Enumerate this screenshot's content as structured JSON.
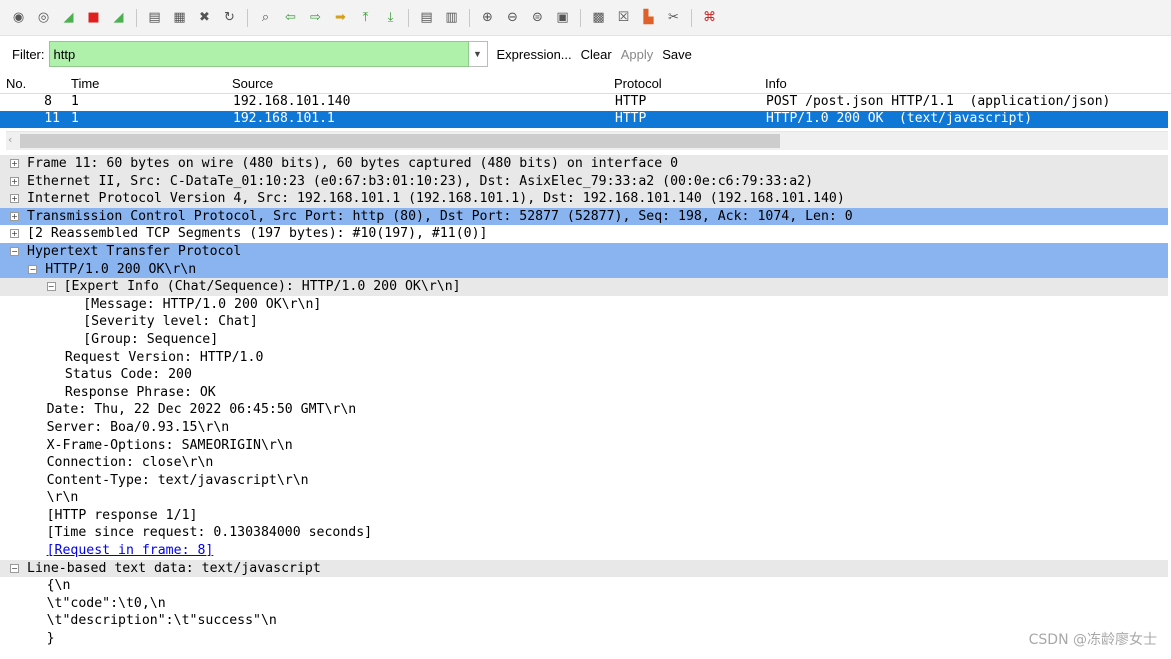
{
  "toolbar": {
    "icons": [
      "start-capture-icon",
      "capture-options-icon",
      "shark-fin-icon",
      "stop-capture-icon",
      "restart-capture-icon",
      "open-file-icon",
      "save-file-icon",
      "close-file-icon",
      "reload-icon",
      "find-packet-icon",
      "go-back-icon",
      "go-forward-icon",
      "go-to-packet-icon",
      "go-first-icon",
      "go-last-icon",
      "colorize-icon",
      "auto-scroll-icon",
      "zoom-in-icon",
      "zoom-out-icon",
      "normal-size-icon",
      "resize-columns-icon",
      "capture-filters-icon",
      "display-filters-icon",
      "coloring-rules-icon",
      "preferences-icon",
      "help-icon"
    ]
  },
  "filter": {
    "label": "Filter:",
    "value": "http",
    "expression": "Expression...",
    "clear": "Clear",
    "apply": "Apply",
    "save": "Save"
  },
  "packet_list": {
    "columns": {
      "no": "No.",
      "time": "Time",
      "source": "Source",
      "protocol": "Protocol",
      "info": "Info"
    },
    "rows": [
      {
        "no": "8",
        "time": "1",
        "source": "192.168.101.140",
        "protocol": "HTTP",
        "info": "POST /post.json HTTP/1.1  (application/json)",
        "selected": false
      },
      {
        "no": "11",
        "time": "1",
        "source": "192.168.101.1",
        "protocol": "HTTP",
        "info": "HTTP/1.0 200 OK  (text/javascript)",
        "selected": true
      }
    ]
  },
  "details": [
    {
      "indent": 0,
      "exp": "+",
      "bg": "gray",
      "text": "Frame 11: 60 bytes on wire (480 bits), 60 bytes captured (480 bits) on interface 0"
    },
    {
      "indent": 0,
      "exp": "+",
      "bg": "gray",
      "text": "Ethernet II, Src: C-DataTe_01:10:23 (e0:67:b3:01:10:23), Dst: AsixElec_79:33:a2 (00:0e:c6:79:33:a2)"
    },
    {
      "indent": 0,
      "exp": "+",
      "bg": "gray",
      "text": "Internet Protocol Version 4, Src: 192.168.101.1 (192.168.101.1), Dst: 192.168.101.140 (192.168.101.140)"
    },
    {
      "indent": 0,
      "exp": "+",
      "bg": "blue",
      "text": "Transmission Control Protocol, Src Port: http (80), Dst Port: 52877 (52877), Seq: 198, Ack: 1074, Len: 0"
    },
    {
      "indent": 0,
      "exp": "+",
      "bg": "none",
      "text": "[2 Reassembled TCP Segments (197 bytes): #10(197), #11(0)]"
    },
    {
      "indent": 0,
      "exp": "-",
      "bg": "blue",
      "text": "Hypertext Transfer Protocol"
    },
    {
      "indent": 1,
      "exp": "-",
      "bg": "blue",
      "text": "HTTP/1.0 200 OK\\r\\n"
    },
    {
      "indent": 2,
      "exp": "-",
      "bg": "gray",
      "text": "[Expert Info (Chat/Sequence): HTTP/1.0 200 OK\\r\\n]"
    },
    {
      "indent": 4,
      "exp": "",
      "bg": "none",
      "text": "[Message: HTTP/1.0 200 OK\\r\\n]"
    },
    {
      "indent": 4,
      "exp": "",
      "bg": "none",
      "text": "[Severity level: Chat]"
    },
    {
      "indent": 4,
      "exp": "",
      "bg": "none",
      "text": "[Group: Sequence]"
    },
    {
      "indent": 3,
      "exp": "",
      "bg": "none",
      "text": "Request Version: HTTP/1.0"
    },
    {
      "indent": 3,
      "exp": "",
      "bg": "none",
      "text": "Status Code: 200"
    },
    {
      "indent": 3,
      "exp": "",
      "bg": "none",
      "text": "Response Phrase: OK"
    },
    {
      "indent": 2,
      "exp": "",
      "bg": "none",
      "text": "Date: Thu, 22 Dec 2022 06:45:50 GMT\\r\\n"
    },
    {
      "indent": 2,
      "exp": "",
      "bg": "none",
      "text": "Server: Boa/0.93.15\\r\\n"
    },
    {
      "indent": 2,
      "exp": "",
      "bg": "none",
      "text": "X-Frame-Options: SAMEORIGIN\\r\\n"
    },
    {
      "indent": 2,
      "exp": "",
      "bg": "none",
      "text": "Connection: close\\r\\n"
    },
    {
      "indent": 2,
      "exp": "",
      "bg": "none",
      "text": "Content-Type: text/javascript\\r\\n"
    },
    {
      "indent": 2,
      "exp": "",
      "bg": "none",
      "text": "\\r\\n"
    },
    {
      "indent": 2,
      "exp": "",
      "bg": "none",
      "text": "[HTTP response 1/1]"
    },
    {
      "indent": 2,
      "exp": "",
      "bg": "none",
      "text": "[Time since request: 0.130384000 seconds]"
    },
    {
      "indent": 2,
      "exp": "",
      "bg": "none",
      "text": "[Request in frame: 8]",
      "link": true
    },
    {
      "indent": 0,
      "exp": "-",
      "bg": "gray",
      "text": "Line-based text data: text/javascript"
    },
    {
      "indent": 2,
      "exp": "",
      "bg": "none",
      "text": "{\\n"
    },
    {
      "indent": 2,
      "exp": "",
      "bg": "none",
      "text": "\\t\"code\":\\t0,\\n"
    },
    {
      "indent": 2,
      "exp": "",
      "bg": "none",
      "text": "\\t\"description\":\\t\"success\"\\n"
    },
    {
      "indent": 2,
      "exp": "",
      "bg": "none",
      "text": "}"
    }
  ],
  "watermark": "CSDN @冻龄廖女士"
}
